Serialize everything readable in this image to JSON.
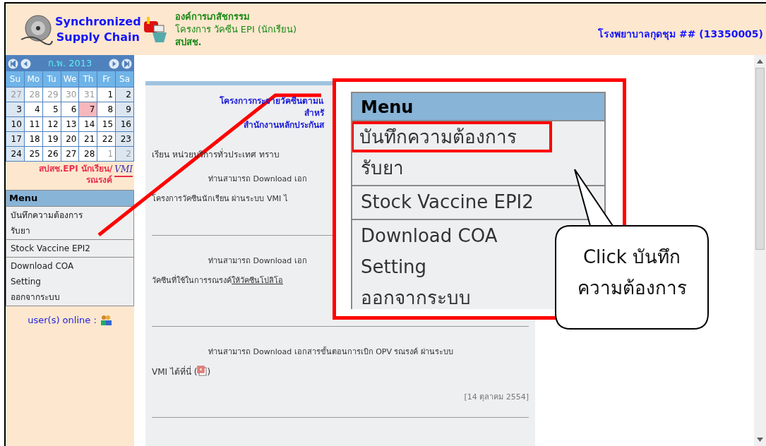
{
  "header": {
    "logo_lines": [
      "Synchronized",
      "Supply Chain"
    ],
    "org_lines": [
      {
        "text": "องค์การเภสัชกรรม",
        "bold": true
      },
      {
        "text": "โครงการ วัคซีน EPI (นักเรียน)",
        "bold": false
      },
      {
        "text": "สปสช.",
        "bold": true
      }
    ],
    "hospital": "โรงพยาบาลกุดชุม ## (13350005)"
  },
  "calendar": {
    "month": "ก.พ. 2013",
    "weekdays": [
      "Su",
      "Mo",
      "Tu",
      "We",
      "Th",
      "Fr",
      "Sa"
    ],
    "weeks": [
      [
        {
          "day": "27",
          "other_month": true,
          "today": false
        },
        {
          "day": "28",
          "other_month": true,
          "today": false
        },
        {
          "day": "29",
          "other_month": true,
          "today": false
        },
        {
          "day": "30",
          "other_month": true,
          "today": false
        },
        {
          "day": "31",
          "other_month": true,
          "today": false
        },
        {
          "day": "1",
          "other_month": false,
          "today": false
        },
        {
          "day": "2",
          "other_month": false,
          "today": false
        }
      ],
      [
        {
          "day": "3",
          "other_month": false,
          "today": false
        },
        {
          "day": "4",
          "other_month": false,
          "today": false
        },
        {
          "day": "5",
          "other_month": false,
          "today": false
        },
        {
          "day": "6",
          "other_month": false,
          "today": false
        },
        {
          "day": "7",
          "other_month": false,
          "today": true
        },
        {
          "day": "8",
          "other_month": false,
          "today": false
        },
        {
          "day": "9",
          "other_month": false,
          "today": false
        }
      ],
      [
        {
          "day": "10",
          "other_month": false,
          "today": false
        },
        {
          "day": "11",
          "other_month": false,
          "today": false
        },
        {
          "day": "12",
          "other_month": false,
          "today": false
        },
        {
          "day": "13",
          "other_month": false,
          "today": false
        },
        {
          "day": "14",
          "other_month": false,
          "today": false
        },
        {
          "day": "15",
          "other_month": false,
          "today": false
        },
        {
          "day": "16",
          "other_month": false,
          "today": false
        }
      ],
      [
        {
          "day": "17",
          "other_month": false,
          "today": false
        },
        {
          "day": "18",
          "other_month": false,
          "today": false
        },
        {
          "day": "19",
          "other_month": false,
          "today": false
        },
        {
          "day": "20",
          "other_month": false,
          "today": false
        },
        {
          "day": "21",
          "other_month": false,
          "today": false
        },
        {
          "day": "22",
          "other_month": false,
          "today": false
        },
        {
          "day": "23",
          "other_month": false,
          "today": false
        }
      ],
      [
        {
          "day": "24",
          "other_month": false,
          "today": false
        },
        {
          "day": "25",
          "other_month": false,
          "today": false
        },
        {
          "day": "26",
          "other_month": false,
          "today": false
        },
        {
          "day": "27",
          "other_month": false,
          "today": false
        },
        {
          "day": "28",
          "other_month": false,
          "today": false
        },
        {
          "day": "1",
          "other_month": true,
          "today": false
        },
        {
          "day": "2",
          "other_month": true,
          "today": false
        }
      ]
    ]
  },
  "program_lines": [
    "สปสช.EPI นักเรียน/",
    "รณรงค์"
  ],
  "vmi_logo": "VMI",
  "sidebar_menu": {
    "title": "Menu",
    "groups": [
      [
        "บันทึกความต้องการ",
        "รับยา"
      ],
      [
        "Stock Vaccine EPI2"
      ],
      [
        "Download COA",
        "Setting",
        "ออกจากระบบ"
      ]
    ]
  },
  "users_online": "user(s) online :",
  "content": {
    "title_lines": [
      "โครงการกระจายวัคซีนตามแ",
      "สำหรั",
      "สำนักงานหลักประกันส"
    ],
    "greeting": "เรียน หน่วยบริการทั่วประเทศ ทราบ",
    "notices": [
      {
        "lines": [
          "ท่านสามารถ Download เอก",
          "โครงการวัคซีนนักเรียน ผ่านระบบ VMI ไ"
        ]
      },
      {
        "lines": [
          "ท่านสามารถ Download เอก",
          "วัคซีนที่ใช้ในการรณรงค์"
        ],
        "link": "ให้วัคซีนโปลิโอ"
      },
      {
        "text_lines": [
          "ท่านสามารถ Download เอกสารขั้นตอนการเบิก OPV รณรงค์ ผ่านระบบ",
          "VMI ได้ที่นี่ ("
        ],
        "after_icon": ")",
        "date": "[14 ตุลาคม 2554]"
      }
    ]
  },
  "zoomed_menu": {
    "title": "Menu",
    "groups": [
      [
        {
          "label": "บันทึกความต้องการ",
          "highlighted": true
        },
        {
          "label": "รับยา",
          "highlighted": false
        }
      ],
      [
        {
          "label": "Stock Vaccine EPI2",
          "highlighted": false
        }
      ],
      [
        {
          "label": "Download COA",
          "highlighted": false
        },
        {
          "label": "Setting",
          "highlighted": false
        },
        {
          "label": "ออกจากระบบ",
          "highlighted": false
        }
      ]
    ]
  },
  "callout": {
    "lines": [
      "Click บันทึก",
      "ความต้องการ"
    ]
  }
}
